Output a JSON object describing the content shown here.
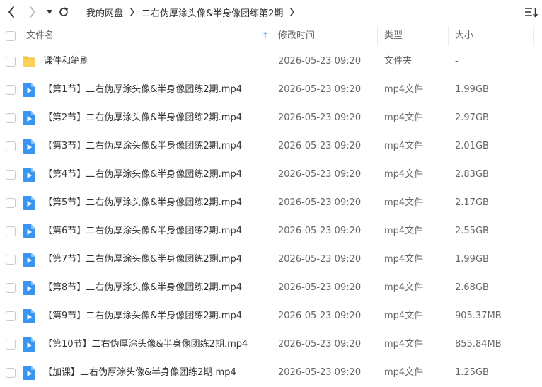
{
  "toolbar": {
    "back_icon": "chevron-left-icon",
    "forward_icon": "chevron-right-icon",
    "history_dropdown_icon": "caret-down-icon",
    "refresh_icon": "refresh-icon",
    "sort_icon": "sort-list-icon"
  },
  "breadcrumb": {
    "items": [
      "我的网盘",
      "二右伪厚涂头像&半身像团练第2期"
    ]
  },
  "columns": {
    "name": "文件名",
    "sort_indicator": "↑",
    "modified": "修改时间",
    "type": "类型",
    "size": "大小"
  },
  "colors": {
    "folder": "#f9c23c",
    "video_icon": "#3a95f0",
    "sort_arrow": "#3a95f0"
  },
  "files": [
    {
      "name": "课件和笔刷",
      "modified": "2026-05-23 09:20",
      "type": "文件夹",
      "size": "-",
      "icon": "folder-icon"
    },
    {
      "name": "【第1节】二右伪厚涂头像&半身像团练2期.mp4",
      "modified": "2026-05-23 09:20",
      "type": "mp4文件",
      "size": "1.99GB",
      "icon": "video-file-icon"
    },
    {
      "name": "【第2节】二右伪厚涂头像&半身像团练2期.mp4",
      "modified": "2026-05-23 09:20",
      "type": "mp4文件",
      "size": "2.97GB",
      "icon": "video-file-icon"
    },
    {
      "name": "【第3节】二右伪厚涂头像&半身像团练2期.mp4",
      "modified": "2026-05-23 09:20",
      "type": "mp4文件",
      "size": "2.01GB",
      "icon": "video-file-icon"
    },
    {
      "name": "【第4节】二右伪厚涂头像&半身像团练2期.mp4",
      "modified": "2026-05-23 09:20",
      "type": "mp4文件",
      "size": "2.83GB",
      "icon": "video-file-icon"
    },
    {
      "name": "【第5节】二右伪厚涂头像&半身像团练2期.mp4",
      "modified": "2026-05-23 09:20",
      "type": "mp4文件",
      "size": "2.17GB",
      "icon": "video-file-icon"
    },
    {
      "name": "【第6节】二右伪厚涂头像&半身像团练2期.mp4",
      "modified": "2026-05-23 09:20",
      "type": "mp4文件",
      "size": "2.55GB",
      "icon": "video-file-icon"
    },
    {
      "name": "【第7节】二右伪厚涂头像&半身像团练2期.mp4",
      "modified": "2026-05-23 09:20",
      "type": "mp4文件",
      "size": "1.99GB",
      "icon": "video-file-icon"
    },
    {
      "name": "【第8节】二右伪厚涂头像&半身像团练2期.mp4",
      "modified": "2026-05-23 09:20",
      "type": "mp4文件",
      "size": "2.68GB",
      "icon": "video-file-icon"
    },
    {
      "name": "【第9节】二右伪厚涂头像&半身像团练2期.mp4",
      "modified": "2026-05-23 09:20",
      "type": "mp4文件",
      "size": "905.37MB",
      "icon": "video-file-icon"
    },
    {
      "name": "【第10节】二右伪厚涂头像&半身像团练2期.mp4",
      "modified": "2026-05-23 09:20",
      "type": "mp4文件",
      "size": "855.84MB",
      "icon": "video-file-icon"
    },
    {
      "name": "【加课】二右伪厚涂头像&半身像团练2期.mp4",
      "modified": "2026-05-23 09:20",
      "type": "mp4文件",
      "size": "1.25GB",
      "icon": "video-file-icon"
    }
  ]
}
